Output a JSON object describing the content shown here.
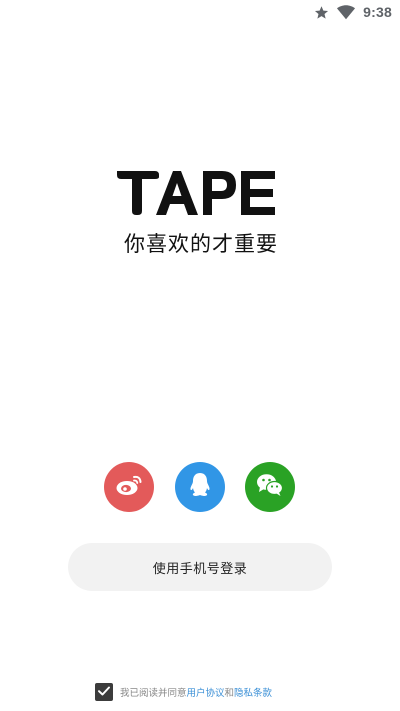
{
  "status_bar": {
    "time": "9:38",
    "icons": [
      "star-icon",
      "wifi-icon"
    ]
  },
  "brand": {
    "logo_text": "TAPE",
    "slogan": "你喜欢的才重要"
  },
  "social_login": [
    {
      "name": "weibo",
      "icon": "weibo-icon",
      "color": "#e35a5a"
    },
    {
      "name": "qq",
      "icon": "qq-icon",
      "color": "#3196e6"
    },
    {
      "name": "wechat",
      "icon": "wechat-icon",
      "color": "#2aa225"
    }
  ],
  "phone_login": {
    "label": "使用手机号登录"
  },
  "agreement": {
    "checked": true,
    "prefix": "我已阅读并同意",
    "user_agreement": "用户协议",
    "conjunction": "和",
    "privacy_terms": "隐私条款",
    "link_color": "#3a8fd6"
  }
}
